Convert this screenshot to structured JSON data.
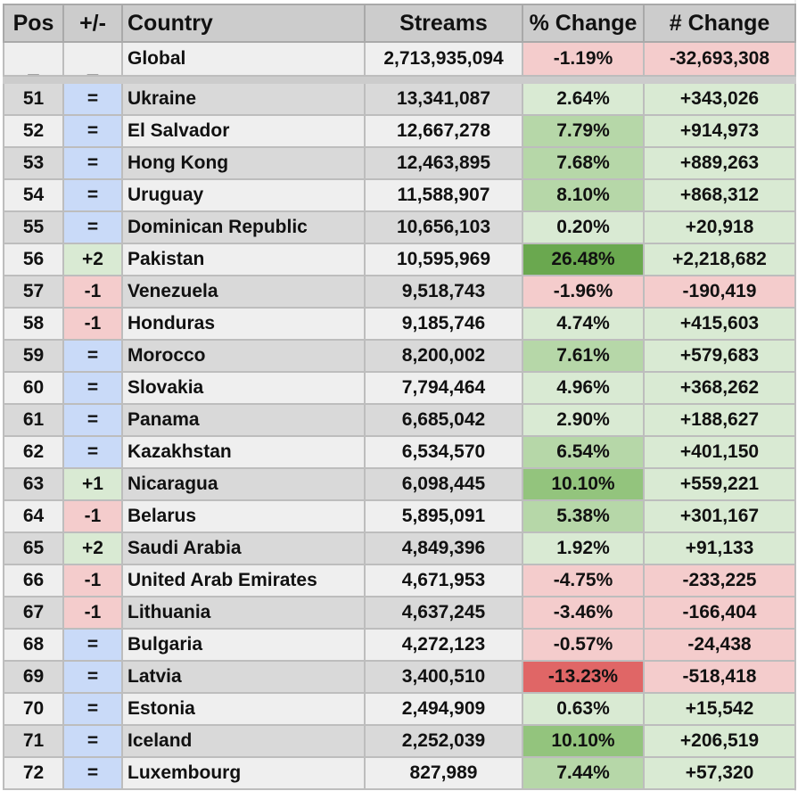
{
  "header": {
    "pos": "Pos",
    "movement": "+/-",
    "country": "Country",
    "streams": "Streams",
    "pct_change": "% Change",
    "num_change": "# Change"
  },
  "global": {
    "pos": "_",
    "movement": "_",
    "country": "Global",
    "streams": "2,713,935,094",
    "pct_change": "-1.19%",
    "num_change": "-32,693,308"
  },
  "colors": {
    "header_bg": "#cccccc",
    "row_dark": "#d9d9d9",
    "row_light": "#efefef",
    "same_blue": "#c9daf8",
    "up_green": "#d9ead3",
    "down_red": "#f4cccc",
    "pct_green_light": "#d9ead3",
    "pct_green_mid": "#b6d7a8",
    "pct_green_strong": "#93c47d",
    "pct_green_max": "#6aa84f",
    "pct_red_light": "#f4cccc",
    "pct_red_strong": "#e06666",
    "border": "#bdbdbd"
  },
  "rows": [
    {
      "pos": "51",
      "movement": "=",
      "country": "Ukraine",
      "streams": "13,341,087",
      "pct_change": "2.64%",
      "num_change": "+343,026",
      "pct_level": "light",
      "trend": "up"
    },
    {
      "pos": "52",
      "movement": "=",
      "country": "El Salvador",
      "streams": "12,667,278",
      "pct_change": "7.79%",
      "num_change": "+914,973",
      "pct_level": "mid",
      "trend": "up"
    },
    {
      "pos": "53",
      "movement": "=",
      "country": "Hong Kong",
      "streams": "12,463,895",
      "pct_change": "7.68%",
      "num_change": "+889,263",
      "pct_level": "mid",
      "trend": "up"
    },
    {
      "pos": "54",
      "movement": "=",
      "country": "Uruguay",
      "streams": "11,588,907",
      "pct_change": "8.10%",
      "num_change": "+868,312",
      "pct_level": "mid",
      "trend": "up"
    },
    {
      "pos": "55",
      "movement": "=",
      "country": "Dominican Republic",
      "streams": "10,656,103",
      "pct_change": "0.20%",
      "num_change": "+20,918",
      "pct_level": "light",
      "trend": "up"
    },
    {
      "pos": "56",
      "movement": "+2",
      "country": "Pakistan",
      "streams": "10,595,969",
      "pct_change": "26.48%",
      "num_change": "+2,218,682",
      "pct_level": "max",
      "trend": "up"
    },
    {
      "pos": "57",
      "movement": "-1",
      "country": "Venezuela",
      "streams": "9,518,743",
      "pct_change": "-1.96%",
      "num_change": "-190,419",
      "pct_level": "light",
      "trend": "down"
    },
    {
      "pos": "58",
      "movement": "-1",
      "country": "Honduras",
      "streams": "9,185,746",
      "pct_change": "4.74%",
      "num_change": "+415,603",
      "pct_level": "light",
      "trend": "up"
    },
    {
      "pos": "59",
      "movement": "=",
      "country": "Morocco",
      "streams": "8,200,002",
      "pct_change": "7.61%",
      "num_change": "+579,683",
      "pct_level": "mid",
      "trend": "up"
    },
    {
      "pos": "60",
      "movement": "=",
      "country": "Slovakia",
      "streams": "7,794,464",
      "pct_change": "4.96%",
      "num_change": "+368,262",
      "pct_level": "light",
      "trend": "up"
    },
    {
      "pos": "61",
      "movement": "=",
      "country": "Panama",
      "streams": "6,685,042",
      "pct_change": "2.90%",
      "num_change": "+188,627",
      "pct_level": "light",
      "trend": "up"
    },
    {
      "pos": "62",
      "movement": "=",
      "country": "Kazakhstan",
      "streams": "6,534,570",
      "pct_change": "6.54%",
      "num_change": "+401,150",
      "pct_level": "mid",
      "trend": "up"
    },
    {
      "pos": "63",
      "movement": "+1",
      "country": "Nicaragua",
      "streams": "6,098,445",
      "pct_change": "10.10%",
      "num_change": "+559,221",
      "pct_level": "strong",
      "trend": "up"
    },
    {
      "pos": "64",
      "movement": "-1",
      "country": "Belarus",
      "streams": "5,895,091",
      "pct_change": "5.38%",
      "num_change": "+301,167",
      "pct_level": "mid",
      "trend": "up"
    },
    {
      "pos": "65",
      "movement": "+2",
      "country": "Saudi Arabia",
      "streams": "4,849,396",
      "pct_change": "1.92%",
      "num_change": "+91,133",
      "pct_level": "light",
      "trend": "up"
    },
    {
      "pos": "66",
      "movement": "-1",
      "country": "United Arab Emirates",
      "streams": "4,671,953",
      "pct_change": "-4.75%",
      "num_change": "-233,225",
      "pct_level": "light",
      "trend": "down"
    },
    {
      "pos": "67",
      "movement": "-1",
      "country": "Lithuania",
      "streams": "4,637,245",
      "pct_change": "-3.46%",
      "num_change": "-166,404",
      "pct_level": "light",
      "trend": "down"
    },
    {
      "pos": "68",
      "movement": "=",
      "country": "Bulgaria",
      "streams": "4,272,123",
      "pct_change": "-0.57%",
      "num_change": "-24,438",
      "pct_level": "light",
      "trend": "down"
    },
    {
      "pos": "69",
      "movement": "=",
      "country": "Latvia",
      "streams": "3,400,510",
      "pct_change": "-13.23%",
      "num_change": "-518,418",
      "pct_level": "strong",
      "trend": "down"
    },
    {
      "pos": "70",
      "movement": "=",
      "country": "Estonia",
      "streams": "2,494,909",
      "pct_change": "0.63%",
      "num_change": "+15,542",
      "pct_level": "light",
      "trend": "up"
    },
    {
      "pos": "71",
      "movement": "=",
      "country": "Iceland",
      "streams": "2,252,039",
      "pct_change": "10.10%",
      "num_change": "+206,519",
      "pct_level": "strong",
      "trend": "up"
    },
    {
      "pos": "72",
      "movement": "=",
      "country": "Luxembourg",
      "streams": "827,989",
      "pct_change": "7.44%",
      "num_change": "+57,320",
      "pct_level": "mid",
      "trend": "up"
    }
  ]
}
